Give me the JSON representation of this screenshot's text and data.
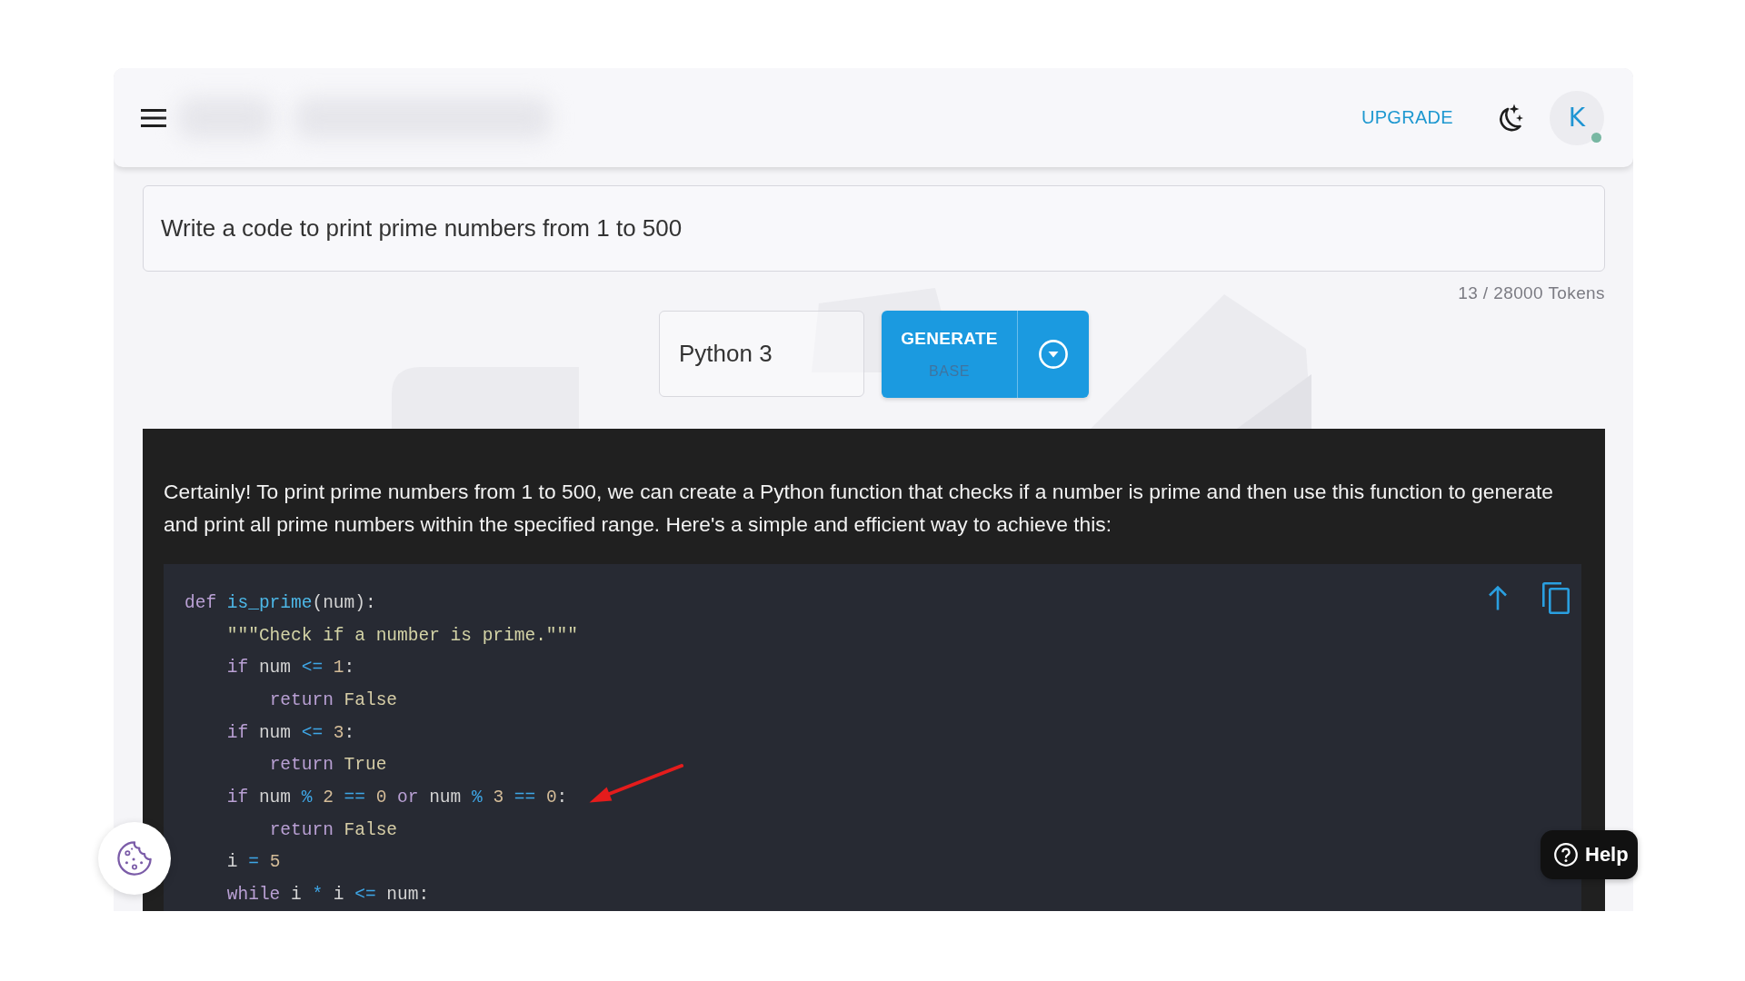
{
  "header": {
    "upgrade_link": "UPGRADE",
    "avatar": {
      "initial": "K",
      "online": true
    }
  },
  "prompt": {
    "value": "Write a code to print prime numbers from 1 to 500"
  },
  "token_count": "13 / 28000 Tokens",
  "language_select": {
    "value": "Python 3"
  },
  "generate_button": {
    "label": "GENERATE",
    "mode": "BASE"
  },
  "response": {
    "text": "Certainly! To print prime numbers from 1 to 500, we can create a Python function that checks if a number is prime and then use this function to generate and print all prime numbers within the specified range. Here's a simple and efficient way to achieve this:",
    "code_block": {
      "lines": [
        {
          "annotated": false,
          "tokens": [
            {
              "kind": "keyword",
              "text": "def "
            },
            {
              "kind": "function",
              "text": "is_prime"
            },
            {
              "kind": "plain",
              "text": "(num):"
            }
          ]
        },
        {
          "annotated": false,
          "tokens": [
            {
              "kind": "string",
              "text": "    \"\"\"Check if a number is prime.\"\"\""
            }
          ]
        },
        {
          "annotated": false,
          "tokens": [
            {
              "kind": "keyword",
              "text": "    if"
            },
            {
              "kind": "plain",
              "text": " num "
            },
            {
              "kind": "operator",
              "text": "<= "
            },
            {
              "kind": "number",
              "text": "1"
            },
            {
              "kind": "plain",
              "text": ":"
            }
          ]
        },
        {
          "annotated": false,
          "tokens": [
            {
              "kind": "keyword",
              "text": "        return "
            },
            {
              "kind": "constant",
              "text": "False"
            }
          ]
        },
        {
          "annotated": false,
          "tokens": [
            {
              "kind": "keyword",
              "text": "    if"
            },
            {
              "kind": "plain",
              "text": " num "
            },
            {
              "kind": "operator",
              "text": "<= "
            },
            {
              "kind": "number",
              "text": "3"
            },
            {
              "kind": "plain",
              "text": ":"
            }
          ]
        },
        {
          "annotated": false,
          "tokens": [
            {
              "kind": "keyword",
              "text": "        return "
            },
            {
              "kind": "constant",
              "text": "True"
            }
          ]
        },
        {
          "annotated": true,
          "tokens": [
            {
              "kind": "keyword",
              "text": "    if"
            },
            {
              "kind": "plain",
              "text": " num "
            },
            {
              "kind": "operator",
              "text": "% "
            },
            {
              "kind": "number",
              "text": "2"
            },
            {
              "kind": "operator",
              "text": " == "
            },
            {
              "kind": "number",
              "text": "0"
            },
            {
              "kind": "keyword",
              "text": " or"
            },
            {
              "kind": "plain",
              "text": " num "
            },
            {
              "kind": "operator",
              "text": "% "
            },
            {
              "kind": "number",
              "text": "3"
            },
            {
              "kind": "operator",
              "text": " == "
            },
            {
              "kind": "number",
              "text": "0"
            },
            {
              "kind": "plain",
              "text": ":"
            }
          ]
        },
        {
          "annotated": false,
          "tokens": [
            {
              "kind": "keyword",
              "text": "        return "
            },
            {
              "kind": "constant",
              "text": "False"
            }
          ]
        },
        {
          "annotated": false,
          "tokens": [
            {
              "kind": "plain",
              "text": "    i "
            },
            {
              "kind": "operator",
              "text": "= "
            },
            {
              "kind": "number",
              "text": "5"
            }
          ]
        },
        {
          "annotated": false,
          "tokens": [
            {
              "kind": "keyword",
              "text": "    while"
            },
            {
              "kind": "plain",
              "text": " i "
            },
            {
              "kind": "operator",
              "text": "*"
            },
            {
              "kind": "plain",
              "text": " i "
            },
            {
              "kind": "operator",
              "text": "<="
            },
            {
              "kind": "plain",
              "text": " num:"
            }
          ]
        }
      ]
    }
  },
  "help_button": {
    "label": "Help"
  }
}
